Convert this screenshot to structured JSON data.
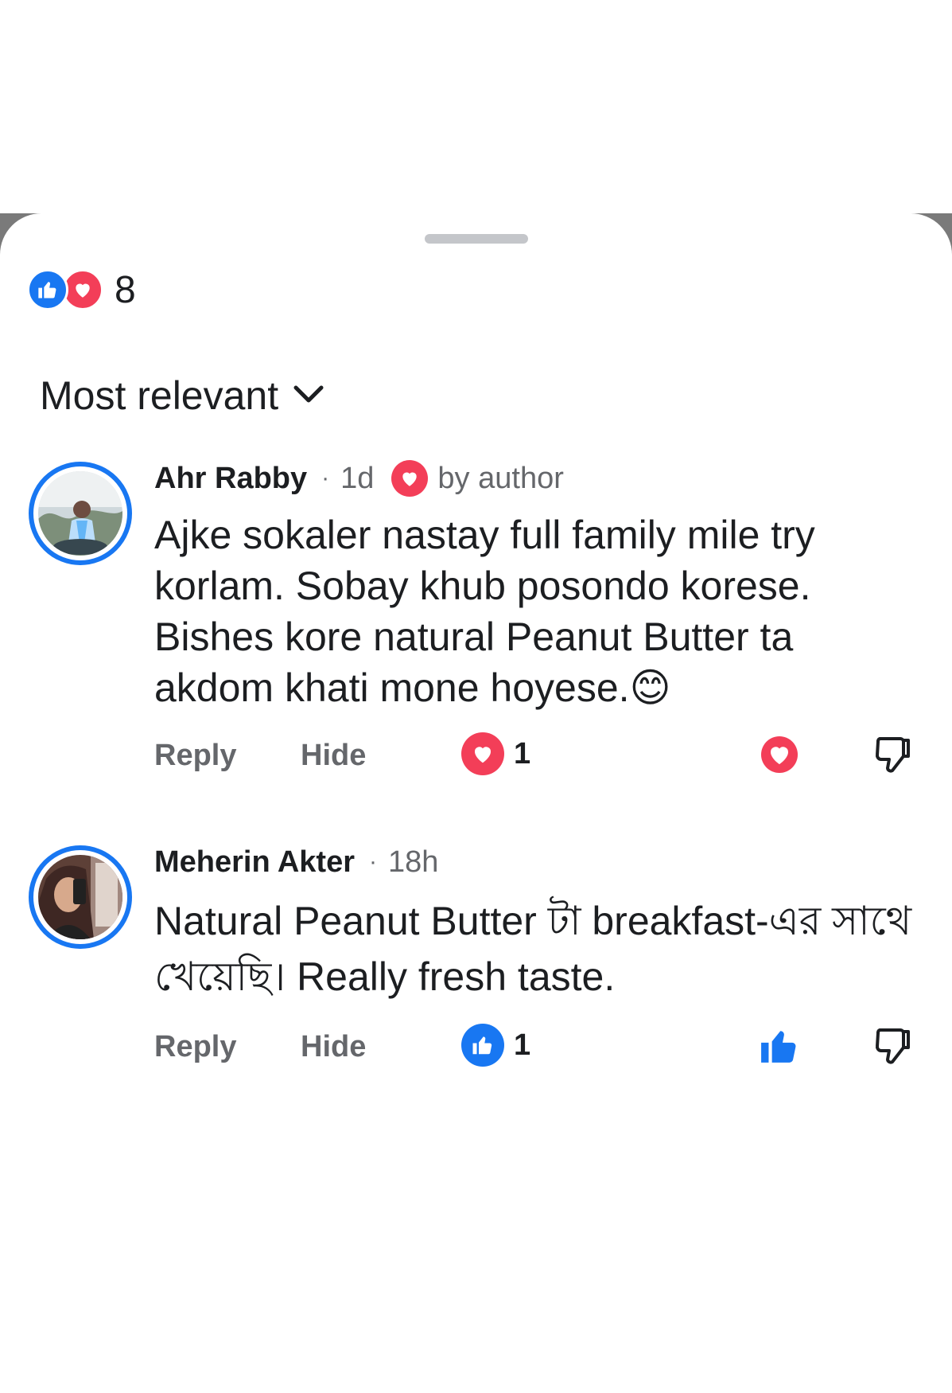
{
  "reaction_summary": {
    "icons": [
      "like-icon",
      "love-icon"
    ],
    "count": "8",
    "colors": {
      "like": "#1877f2",
      "love": "#f33e58"
    }
  },
  "sort": {
    "label": "Most relevant",
    "icon": "chevron-down-icon"
  },
  "comments": [
    {
      "author": "Ahr Rabby",
      "time": "1d",
      "author_badge": "by author",
      "text": "Ajke sokaler nastay full family mile try korlam. Sobay khub posondo korese. Bishes kore natural Peanut Butter ta akdom khati mone hoyese.😊",
      "actions": {
        "reply": "Reply",
        "hide": "Hide"
      },
      "reaction": {
        "type": "love",
        "count": "1"
      },
      "my_reaction": "love-icon"
    },
    {
      "author": "Meherin Akter",
      "time": "18h",
      "text": "Natural Peanut Butter টা breakfast-এর সাথে খেয়েছি। Really fresh taste.",
      "actions": {
        "reply": "Reply",
        "hide": "Hide"
      },
      "reaction": {
        "type": "like",
        "count": "1"
      },
      "my_reaction": "like-icon"
    }
  ]
}
